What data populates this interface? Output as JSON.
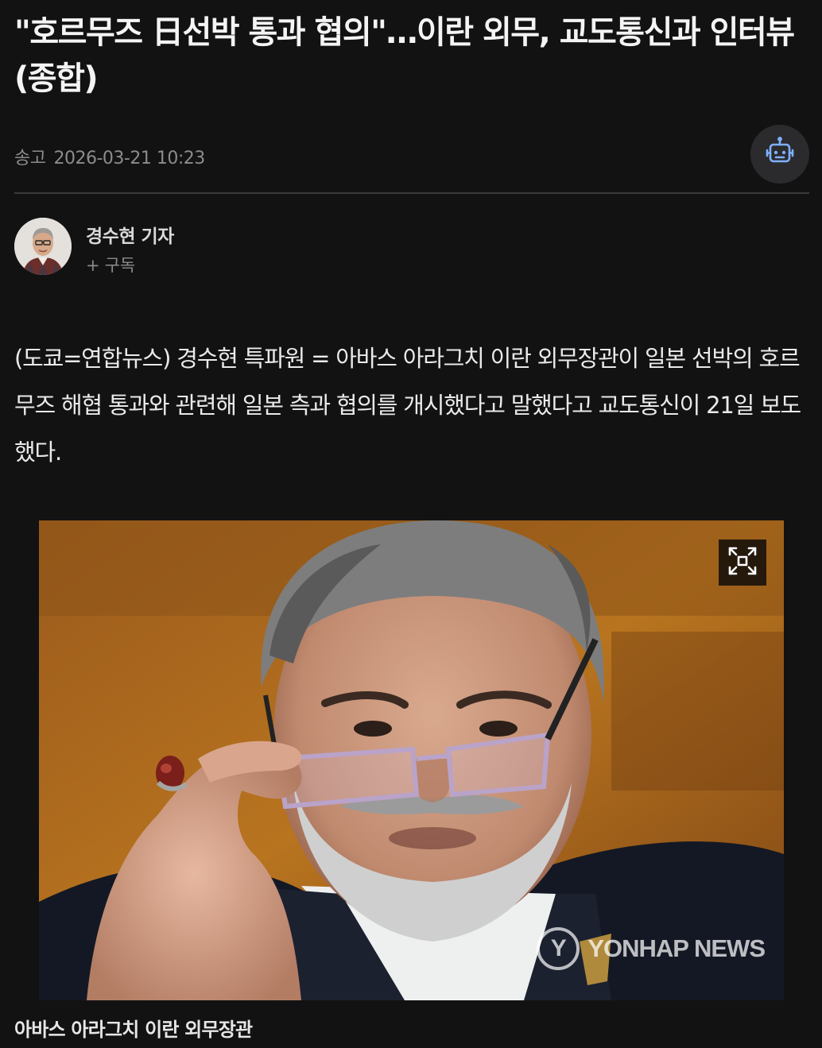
{
  "article": {
    "headline": "\"호르무즈 日선박 통과 협의\"…이란 외무, 교도통신과 인터뷰(종합)",
    "published_label": "송고",
    "published_time": "2026-03-21 10:23",
    "ai_button_icon": "robot-icon"
  },
  "byline": {
    "reporter_name": "경수현 기자",
    "subscribe_plus": "+",
    "subscribe_label": "구독"
  },
  "body": {
    "lead": "(도쿄=연합뉴스) 경수현 특파원 = 아바스 아라그치 이란 외무장관이 일본 선박의 호르무즈 해협 통과와 관련해 일본 측과 협의를 개시했다고 말했다고 교도통신이 21일 보도했다."
  },
  "photo": {
    "expand_icon": "expand-icon",
    "watermark_mark": "Y",
    "watermark_text": "YONHAP NEWS",
    "caption": "아바스 아라그치 이란 외무장관"
  },
  "colors": {
    "background": "#121212",
    "ai_icon": "#7fb0ff",
    "meta_text": "#8c8c8c"
  }
}
